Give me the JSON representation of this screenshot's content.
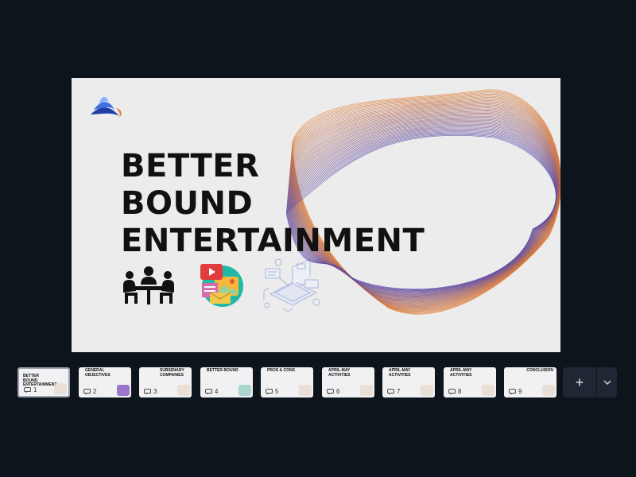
{
  "slide": {
    "title_lines": [
      "BETTER",
      "BOUND",
      "ENTERTAINMENT"
    ],
    "icons": [
      "brand-logo-icon",
      "meeting-people-icon",
      "media-gallery-icon",
      "laptop-workflow-icon"
    ],
    "colors": {
      "background": "#ececec",
      "wave_orange": "#e07a2e",
      "wave_purple": "#5b4aa8",
      "title": "#111111"
    }
  },
  "thumbnails": [
    {
      "number": "1",
      "title": "BETTER BOUND ENTERTAINMENT",
      "active": true
    },
    {
      "number": "2",
      "title": "GENERAL OBJECTIVES",
      "active": false
    },
    {
      "number": "3",
      "title": "SUBSIDIARY COMPANIES",
      "active": false
    },
    {
      "number": "4",
      "title": "BETTER BOUND",
      "active": false
    },
    {
      "number": "5",
      "title": "PROS & CONS",
      "active": false
    },
    {
      "number": "6",
      "title": "APRIL-MAY ACTIVITIES",
      "active": false
    },
    {
      "number": "7",
      "title": "APRIL-MAY ACTIVITIES",
      "active": false
    },
    {
      "number": "8",
      "title": "APRIL-MAY ACTIVITIES",
      "active": false
    },
    {
      "number": "9",
      "title": "CONCLUSION",
      "active": false
    }
  ],
  "toolbar": {
    "add_label": "+",
    "more_icon": "chevron-down-icon"
  },
  "page": {
    "background": "#0e141b"
  }
}
